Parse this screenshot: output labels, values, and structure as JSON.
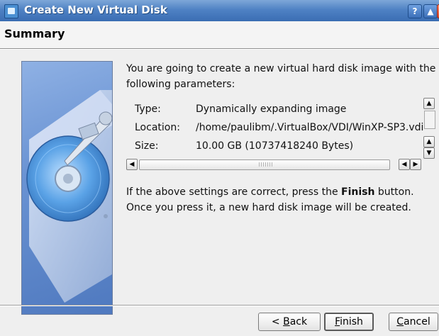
{
  "window": {
    "title": "Create New Virtual Disk",
    "buttons": {
      "help": "?",
      "shade": "▲",
      "close": "✕"
    }
  },
  "header": {
    "title": "Summary"
  },
  "intro": {
    "text": "You are going to create a new virtual hard disk image with the following parameters:"
  },
  "parameters": [
    {
      "label": "Type:",
      "value": "Dynamically expanding image"
    },
    {
      "label": "Location:",
      "value": "/home/paulibm/.VirtualBox/VDI/WinXP-SP3.vdi"
    },
    {
      "label": "Size:",
      "value": "10.00 GB (10737418240 Bytes)"
    }
  ],
  "scroll_arrows": {
    "up": "▲",
    "down": "▼",
    "left": "◀",
    "right": "▶"
  },
  "finish_hint": {
    "line1_before": "If the above settings are correct, press the ",
    "line1_bold": "Finish",
    "line1_after": " button.",
    "line2": "Once you press it, a new hard disk image will be created."
  },
  "buttons": {
    "back_prefix": "< ",
    "back_mnemonic": "B",
    "back_rest": "ack",
    "finish_mnemonic": "F",
    "finish_rest": "inish",
    "cancel_mnemonic": "C",
    "cancel_rest": "ancel"
  },
  "colors": {
    "titlebar": "#4f82c4",
    "background": "#efefef",
    "disk": "#4a8fd8"
  },
  "icons": {
    "side_image": "hard-disk-illustration",
    "app": "virtualbox-icon"
  }
}
